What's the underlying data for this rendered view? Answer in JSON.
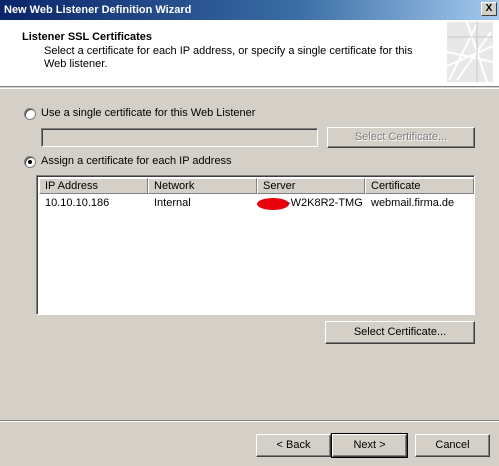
{
  "window": {
    "title": "New Web Listener Definition Wizard",
    "close_label": "X"
  },
  "header": {
    "title": "Listener SSL Certificates",
    "description": "Select a certificate for each IP address, or specify a single certificate for this Web listener."
  },
  "options": {
    "single": {
      "label": "Use a single certificate for this Web Listener",
      "checked": false,
      "input_value": "",
      "button_label": "Select Certificate...",
      "button_enabled": false
    },
    "per_ip": {
      "label": "Assign a certificate for each IP address",
      "checked": true
    }
  },
  "table": {
    "columns": [
      "IP Address",
      "Network",
      "Server",
      "Certificate"
    ],
    "rows": [
      {
        "ip": "10.10.10.186",
        "network": "Internal",
        "server": "-W2K8R2-TMG",
        "certificate": "webmail.firma.de"
      }
    ]
  },
  "select_certificate_label": "Select Certificate...",
  "footer": {
    "back_label": "< Back",
    "next_label": "Next >",
    "cancel_label": "Cancel"
  },
  "colors": {
    "dialog_bg": "#d4d0c8",
    "titlebar_start": "#0a246a",
    "titlebar_end": "#a6caf0",
    "redaction": "#e8000a"
  }
}
